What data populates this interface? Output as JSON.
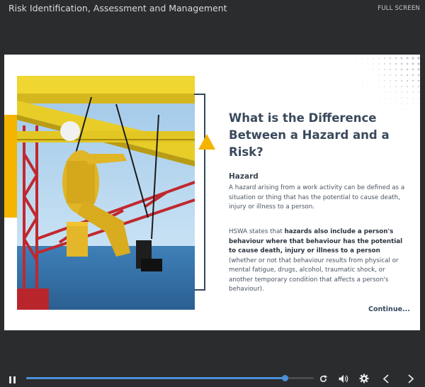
{
  "app": {
    "title": "Risk Identification, Assessment and Management",
    "fullscreen_label": "FULL SCREEN"
  },
  "slide": {
    "heading_lines": [
      "What is the Difference",
      "Between a Hazard and a",
      "Risk?"
    ],
    "hazard_title": "Hazard",
    "hazard_text": "A hazard arising from a work activity can be defined as a situation or thing that has the potential to cause death, injury or illness to a person.",
    "hswa": {
      "t1": "HSWA states that ",
      "b1": "hazards also include a person's behaviour where that behaviour has the potential to cause death, injury or illness to a person",
      "t2": " (whether or not that behaviour results from physical or mental fatigue, drugs, alcohol, traumatic shock, or another temporary condition that affects a person's behaviour)."
    },
    "continue_label": "Continue...",
    "photo_icon": "industrial-rope-access-worker-photo"
  },
  "player": {
    "progress": 0.9,
    "icons": [
      "pause-icon",
      "replay-icon",
      "volume-icon",
      "settings-icon",
      "previous-icon",
      "next-icon"
    ]
  },
  "colors": {
    "background": "#2b2c2e",
    "accent_yellow": "#f4b400",
    "heading": "#3a4a5c",
    "progress": "#4a90d9"
  }
}
